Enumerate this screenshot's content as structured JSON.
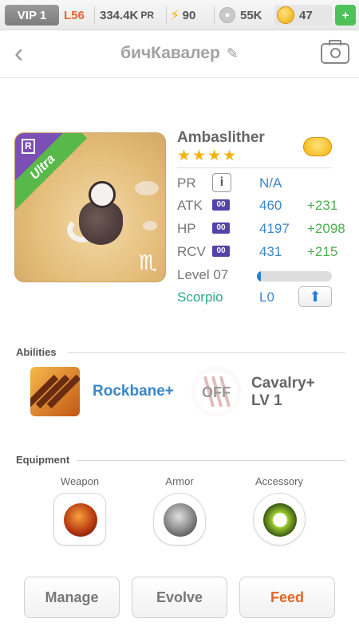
{
  "topbar": {
    "vip": "VIP 1",
    "level": "L56",
    "pr_value": "334.4K",
    "pr_unit": "PR",
    "energy": "90",
    "paw_value": "55K",
    "gold": "47",
    "plus": "+"
  },
  "header": {
    "back": "‹",
    "title": "бичКавалер",
    "edit_icon": "pencil-icon",
    "camera_icon": "camera-icon"
  },
  "monster": {
    "name": "Ambaslither",
    "stars": "★★★★",
    "rarity": "Ultra",
    "rarity_badge": "R",
    "zodiac_symbol": "♏",
    "stats": {
      "pr": {
        "label": "PR",
        "value": "N/A",
        "icon": "i"
      },
      "atk": {
        "label": "ATK",
        "badge": "00",
        "value": "460",
        "bonus": "+231"
      },
      "hp": {
        "label": "HP",
        "badge": "00",
        "value": "4197",
        "bonus": "+2098"
      },
      "rcv": {
        "label": "RCV",
        "badge": "00",
        "value": "431",
        "bonus": "+215"
      }
    },
    "level_label": "Level 07",
    "level_progress": 0.05,
    "sign": "Scorpio",
    "sign_level": "L0",
    "up_icon": "⬆"
  },
  "abilities": {
    "title": "Abilities",
    "items": [
      {
        "name": "Rockbane+"
      },
      {
        "name_line1": "Cavalry+",
        "name_line2": "LV 1",
        "status": "OFF"
      }
    ]
  },
  "equipment": {
    "title": "Equipment",
    "slots": [
      {
        "label": "Weapon"
      },
      {
        "label": "Armor"
      },
      {
        "label": "Accessory"
      }
    ]
  },
  "actions": {
    "manage": "Manage",
    "evolve": "Evolve",
    "feed": "Feed"
  },
  "colors": {
    "accent_blue": "#3b87c9",
    "bonus_green": "#4caf50",
    "feed_orange": "#e0672b",
    "ultra_green": "#58b84a",
    "rare_purple": "#7b4fb5"
  }
}
